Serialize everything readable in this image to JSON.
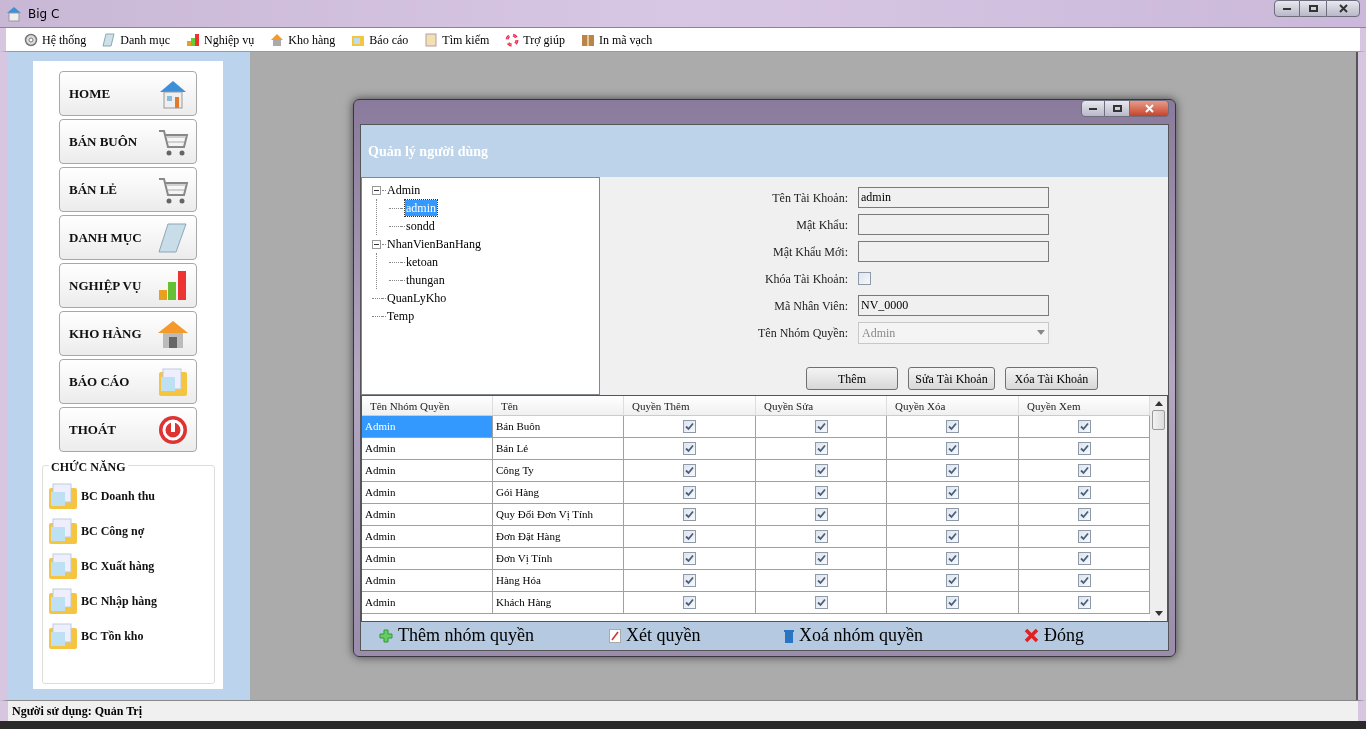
{
  "window": {
    "title": "Big C"
  },
  "menu": [
    {
      "label": "Hệ thống"
    },
    {
      "label": "Danh mục"
    },
    {
      "label": "Nghiệp vụ"
    },
    {
      "label": "Kho hàng"
    },
    {
      "label": "Báo cáo"
    },
    {
      "label": "Tìm kiếm"
    },
    {
      "label": "Trợ giúp"
    },
    {
      "label": "In mã vạch"
    }
  ],
  "sidebar": {
    "buttons": [
      {
        "label": "HOME"
      },
      {
        "label": "BÁN BUÔN"
      },
      {
        "label": "BÁN LẺ"
      },
      {
        "label": "DANH MỤC"
      },
      {
        "label": "NGHIỆP VỤ"
      },
      {
        "label": "KHO HÀNG"
      },
      {
        "label": "BÁO CÁO"
      },
      {
        "label": "THOÁT"
      }
    ],
    "group": {
      "title": "CHỨC NĂNG",
      "items": [
        "BC Doanh thu",
        "BC Công nợ",
        "BC Xuất hàng",
        "BC Nhập hàng",
        "BC Tồn kho"
      ]
    }
  },
  "dialog": {
    "header": "Quản lý người dùng",
    "tree": [
      {
        "label": "Admin",
        "selected": false,
        "expanded": true,
        "children": [
          {
            "label": "admin",
            "selected": true
          },
          {
            "label": "sondd",
            "selected": false
          }
        ]
      },
      {
        "label": "NhanVienBanHang",
        "selected": false,
        "expanded": true,
        "children": [
          {
            "label": "ketoan",
            "selected": false
          },
          {
            "label": "thungan",
            "selected": false
          }
        ]
      },
      {
        "label": "QuanLyKho",
        "selected": false
      },
      {
        "label": "Temp",
        "selected": false
      }
    ],
    "form": [
      {
        "kind": "text",
        "label": "Tên Tài Khoản:",
        "value": "admin"
      },
      {
        "kind": "text",
        "label": "Mật Khẩu:"
      },
      {
        "kind": "text",
        "label": "Mật Khẩu Mới:"
      },
      {
        "kind": "checkbox",
        "label": "Khóa Tài Khoản:",
        "checked": false
      },
      {
        "kind": "text",
        "label": "Mã Nhân Viên:",
        "value": "NV_0000"
      },
      {
        "kind": "select",
        "label": "Tên Nhóm Quyền:",
        "value": "Admin",
        "disabled": true
      }
    ],
    "buttons": [
      "Thêm",
      "Sửa Tài Khoản",
      "Xóa Tài Khoản"
    ],
    "grid": {
      "columns": [
        "Tên Nhóm Quyền",
        "Tên",
        "Quyền Thêm",
        "Quyền Sửa",
        "Quyền Xóa",
        "Quyền Xem"
      ],
      "rows": [
        {
          "cells": [
            "Admin",
            "Bán Buôn"
          ],
          "perms": [
            true,
            true,
            true,
            true
          ],
          "selected": true
        },
        {
          "cells": [
            "Admin",
            "Bán Lẻ"
          ],
          "perms": [
            true,
            true,
            true,
            true
          ],
          "selected": false
        },
        {
          "cells": [
            "Admin",
            "Công Ty"
          ],
          "perms": [
            true,
            true,
            true,
            true
          ],
          "selected": false
        },
        {
          "cells": [
            "Admin",
            "Gói Hàng"
          ],
          "perms": [
            true,
            true,
            true,
            true
          ],
          "selected": false
        },
        {
          "cells": [
            "Admin",
            "Quy Đổi Đơn Vị Tính"
          ],
          "perms": [
            true,
            true,
            true,
            true
          ],
          "selected": false
        },
        {
          "cells": [
            "Admin",
            "Đơn Đặt Hàng"
          ],
          "perms": [
            true,
            true,
            true,
            true
          ],
          "selected": false
        },
        {
          "cells": [
            "Admin",
            "Đơn Vị Tính"
          ],
          "perms": [
            true,
            true,
            true,
            true
          ],
          "selected": false
        },
        {
          "cells": [
            "Admin",
            "Hàng Hóa"
          ],
          "perms": [
            true,
            true,
            true,
            true
          ],
          "selected": false
        },
        {
          "cells": [
            "Admin",
            "Khách Hàng"
          ],
          "perms": [
            true,
            true,
            true,
            true
          ],
          "selected": false
        }
      ]
    },
    "toolbar": [
      {
        "label": "Thêm nhóm quyền"
      },
      {
        "label": "Xét quyền"
      },
      {
        "label": "Xoá nhóm quyền"
      },
      {
        "label": "Đóng"
      }
    ]
  },
  "status_bar": "Người sử dụng: Quản Trị"
}
